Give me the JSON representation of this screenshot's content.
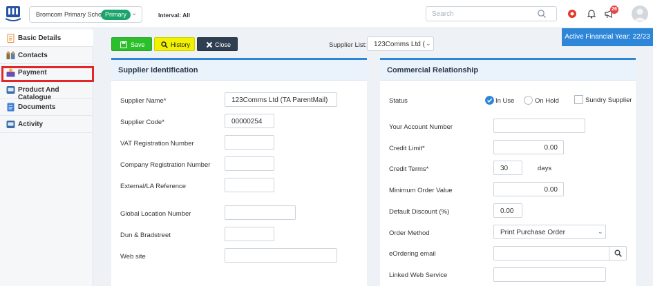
{
  "header": {
    "school_name": "Bromcom Primary School",
    "school_badge": "Primary",
    "interval": "Interval: All",
    "search_placeholder": "Search",
    "notification_count": "26"
  },
  "sidebar": {
    "items": [
      {
        "label": "Basic Details",
        "icon": "document-icon"
      },
      {
        "label": "Contacts",
        "icon": "contacts-icon"
      },
      {
        "label": "Payment",
        "icon": "payment-icon"
      },
      {
        "label": "Product And Catalogue",
        "icon": "catalogue-icon"
      },
      {
        "label": "Documents",
        "icon": "documents-icon"
      },
      {
        "label": "Activity",
        "icon": "activity-icon"
      }
    ]
  },
  "toolbar": {
    "save_label": "Save",
    "history_label": "History",
    "close_label": "Close",
    "supplier_list_label": "Supplier List:",
    "supplier_list_value": "123Comms Ltd ("
  },
  "financial_year": "Active Financial Year: 22/23",
  "supplier_identification": {
    "title": "Supplier Identification",
    "fields": {
      "supplier_name": {
        "label": "Supplier Name*",
        "value": "123Comms Ltd (TA ParentMail)"
      },
      "supplier_code": {
        "label": "Supplier Code*",
        "value": "00000254"
      },
      "vat_number": {
        "label": "VAT Registration Number",
        "value": ""
      },
      "company_number": {
        "label": "Company Registration Number",
        "value": ""
      },
      "external_ref": {
        "label": "External/LA Reference",
        "value": ""
      },
      "gln": {
        "label": "Global Location Number",
        "value": ""
      },
      "duns": {
        "label": "Dun & Bradstreet",
        "value": ""
      },
      "website": {
        "label": "Web site",
        "value": ""
      }
    }
  },
  "commercial_relationship": {
    "title": "Commercial Relationship",
    "status_label": "Status",
    "status_options": {
      "in_use": "In Use",
      "on_hold": "On Hold",
      "sundry": "Sundry Supplier"
    },
    "status_selected": "In Use",
    "fields": {
      "account_number": {
        "label": "Your Account Number",
        "value": ""
      },
      "credit_limit": {
        "label": "Credit Limit*",
        "value": "0.00"
      },
      "credit_terms": {
        "label": "Credit Terms*",
        "value": "30",
        "suffix": "days"
      },
      "min_order": {
        "label": "Minimum Order Value",
        "value": "0.00"
      },
      "default_discount": {
        "label": "Default Discount (%)",
        "value": "0.00"
      },
      "order_method": {
        "label": "Order Method",
        "value": "Print Purchase Order"
      },
      "eordering_email": {
        "label": "eOrdering email",
        "value": ""
      },
      "linked_web_service": {
        "label": "Linked Web Service",
        "value": ""
      }
    }
  },
  "colors": {
    "accent": "#2e86d8",
    "save": "#2bc02b",
    "history": "#f2f200",
    "close": "#2f3f52",
    "badge": "#1aa36b",
    "highlight": "#e2262b"
  }
}
